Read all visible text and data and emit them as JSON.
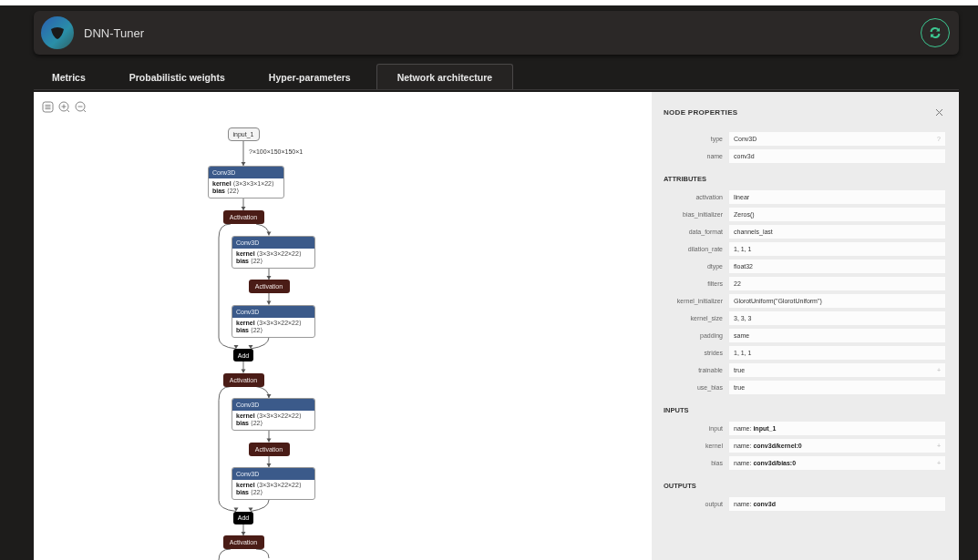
{
  "app": {
    "title": "DNN-Tuner"
  },
  "tabs": [
    {
      "label": "Metrics",
      "selected": false
    },
    {
      "label": "Probabilistic weights",
      "selected": false
    },
    {
      "label": "Hyper-parameters",
      "selected": false
    },
    {
      "label": "Network architecture",
      "selected": true
    }
  ],
  "graph": {
    "nodes": [
      {
        "kind": "input",
        "label": "input_1",
        "output_shape": "?×100×150×150×1"
      },
      {
        "kind": "conv",
        "label": "Conv3D",
        "lines": [
          "**kernel** ⟨3×3×3×1×22⟩",
          "**bias** ⟨22⟩"
        ]
      },
      {
        "kind": "activation",
        "label": "Activation"
      },
      {
        "kind": "conv",
        "label": "Conv3D",
        "lines": [
          "**kernel** ⟨3×3×3×22×22⟩",
          "**bias** ⟨22⟩"
        ]
      },
      {
        "kind": "activation",
        "label": "Activation"
      },
      {
        "kind": "conv",
        "label": "Conv3D",
        "lines": [
          "**kernel** ⟨3×3×3×22×22⟩",
          "**bias** ⟨22⟩"
        ]
      },
      {
        "kind": "add",
        "label": "Add"
      },
      {
        "kind": "activation",
        "label": "Activation"
      },
      {
        "kind": "conv",
        "label": "Conv3D",
        "lines": [
          "**kernel** ⟨3×3×3×22×22⟩",
          "**bias** ⟨22⟩"
        ]
      },
      {
        "kind": "activation",
        "label": "Activation"
      },
      {
        "kind": "conv",
        "label": "Conv3D",
        "lines": [
          "**kernel** ⟨3×3×3×22×22⟩",
          "**bias** ⟨22⟩"
        ]
      },
      {
        "kind": "add",
        "label": "Add"
      },
      {
        "kind": "activation",
        "label": "Activation"
      }
    ]
  },
  "properties": {
    "title": "NODE PROPERTIES",
    "sections": [
      {
        "rows": [
          {
            "label": "type",
            "value": "Conv3D",
            "action": "?"
          },
          {
            "label": "name",
            "value": "conv3d"
          }
        ]
      },
      {
        "heading": "ATTRIBUTES",
        "rows": [
          {
            "label": "activation",
            "value": "linear"
          },
          {
            "label": "bias_initializer",
            "value": "Zeros()"
          },
          {
            "label": "data_format",
            "value": "channels_last"
          },
          {
            "label": "dilation_rate",
            "value": "1, 1, 1"
          },
          {
            "label": "dtype",
            "value": "float32"
          },
          {
            "label": "filters",
            "value": "22"
          },
          {
            "label": "kernel_initializer",
            "value": "GlorotUniform(\"GlorotUniform\")"
          },
          {
            "label": "kernel_size",
            "value": "3, 3, 3"
          },
          {
            "label": "padding",
            "value": "same"
          },
          {
            "label": "strides",
            "value": "1, 1, 1"
          },
          {
            "label": "trainable",
            "value": "true",
            "action": "+"
          },
          {
            "label": "use_bias",
            "value": "true"
          }
        ]
      },
      {
        "heading": "INPUTS",
        "rows": [
          {
            "label": "input",
            "value": "name: **input_1**"
          },
          {
            "label": "kernel",
            "value": "name: **conv3d/kernel:0**",
            "action": "+"
          },
          {
            "label": "bias",
            "value": "name: **conv3d/bias:0**",
            "action": "+"
          }
        ]
      },
      {
        "heading": "OUTPUTS",
        "rows": [
          {
            "label": "output",
            "value": "name: **conv3d**"
          }
        ]
      }
    ]
  }
}
